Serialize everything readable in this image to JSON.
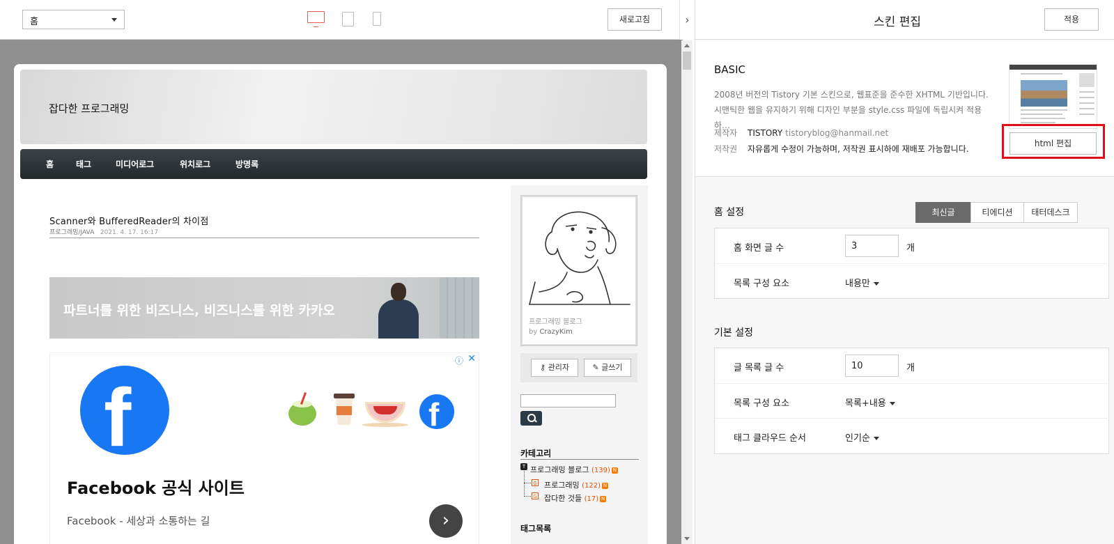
{
  "preview": {
    "page_select": "홈",
    "refresh_label": "새로고침",
    "collapse_glyph": "›"
  },
  "blog": {
    "title": "잡다한 프로그래밍",
    "nav": [
      "홈",
      "태그",
      "미디어로그",
      "위치로그",
      "방명록"
    ],
    "post": {
      "title": "Scanner와 BufferedReader의 차이점",
      "category": "프로그래밍/JAVA",
      "date": "2021. 4. 17. 16:17"
    },
    "ad_banner_text": "파트너를 위한 비즈니스, 비즈니스를 위한 카카오",
    "ad": {
      "headline": "Facebook 공식 사이트",
      "desc": "Facebook - 세상과 소통하는 길",
      "info_glyph": "ⓘ",
      "close_glyph": "✕",
      "fb_letter": "f",
      "arrow_glyph": "›"
    },
    "sidebar": {
      "profile_name": "프로그래밍 블로그",
      "profile_by": "by",
      "profile_author": "CrazyKim",
      "admin_label": "관리자",
      "write_label": "글쓰기",
      "category_heading": "카테고리",
      "categories": [
        {
          "icon": "T",
          "name": "프로그래밍 블로그",
          "count": "(139)",
          "new": "N"
        },
        {
          "icon": "G",
          "name": "프로그래밍",
          "count": "(122)",
          "new": "N"
        },
        {
          "icon": "G",
          "name": "잡다한 것들",
          "count": "(17)",
          "new": "N"
        }
      ],
      "tag_heading": "태그목록"
    }
  },
  "panel": {
    "title": "스킨 편집",
    "apply_label": "적용",
    "skin": {
      "name": "BASIC",
      "desc": "2008년 버전의 Tistory 기본 스킨으로, 웹표준을 준수한 XHTML 기반입니다. 시맨틱한 웹을 유지하기 위해 디자인 부분을 style.css 파일에 독립시켜 적용하…",
      "maker_label": "제작자",
      "maker": "TISTORY",
      "maker_email": "tistoryblog@hanmail.net",
      "copyright_label": "저작권",
      "copyright": "자유롭게 수정이 가능하며, 저작권 표시하에 재배포 가능합니다.",
      "html_edit_label": "html 편집"
    },
    "home_settings": {
      "title": "홈 설정",
      "tabs": [
        "최신글",
        "티에디션",
        "태터데스크"
      ],
      "active_tab": 0,
      "post_count_label": "홈 화면 글 수",
      "post_count": "3",
      "post_count_unit": "개",
      "list_component_label": "목록 구성 요소",
      "list_component": "내용만"
    },
    "basic_settings": {
      "title": "기본 설정",
      "list_count_label": "글 목록 글 수",
      "list_count": "10",
      "list_count_unit": "개",
      "list_component_label": "목록 구성 요소",
      "list_component": "목록+내용",
      "tag_cloud_label": "태그 클라우드 순서",
      "tag_cloud": "인기순"
    }
  },
  "colors": {
    "accent_red": "#e30d18",
    "facebook_blue": "#1877f2",
    "nav_dark": "#2b3135",
    "active_tab": "#6b6b6b"
  }
}
